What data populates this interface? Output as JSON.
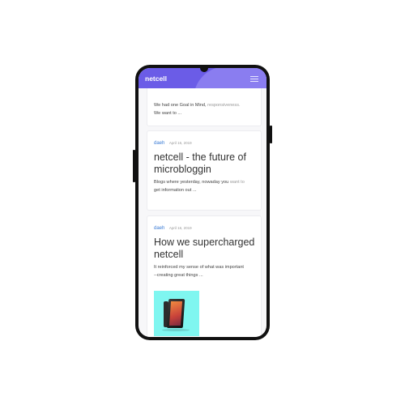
{
  "app": {
    "brand": "netcell"
  },
  "posts": [
    {
      "excerpt_main": "We had one Goal in Mind, ",
      "excerpt_muted": "responsiveness.",
      "excerpt_tail": "We want to ..."
    },
    {
      "author": "daeh",
      "date": "April 16, 2019",
      "title": "netcell - the future of microbloggin",
      "excerpt_main": "Blogs where yesterday, nowaday you ",
      "excerpt_muted": "want to",
      "excerpt_tail": "get information out ..."
    },
    {
      "author": "daeh",
      "date": "April 16, 2019",
      "title": "How we supercharged netcell",
      "excerpt_main": "It reinforced my sense of what was important",
      "excerpt_tail": "--creating great things ...",
      "image": "smartphone-product-photo"
    }
  ],
  "colors": {
    "header": "#6b5ce7",
    "accent": "#3a7bd5",
    "thumb_bg": "#7ff6f0"
  }
}
